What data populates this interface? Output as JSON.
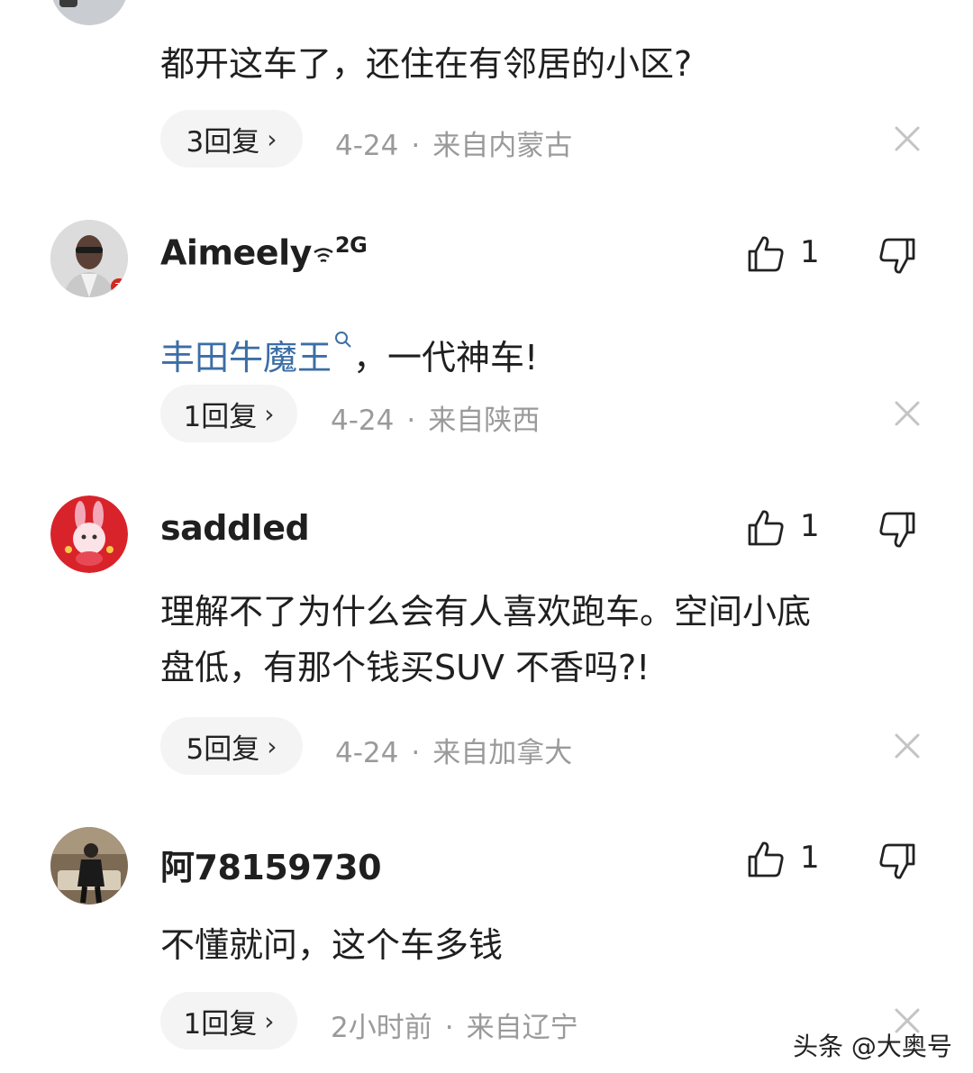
{
  "comments": [
    {
      "username": "",
      "content": "都开这车了，还住在有邻居的小区?",
      "replies": "3回复",
      "date": "4-24",
      "location": "来自内蒙古"
    },
    {
      "username": "Aimeely",
      "badge": "2G",
      "topic": "丰田牛魔王",
      "content": "，一代神车!",
      "likes": "1",
      "replies": "1回复",
      "date": "4-24",
      "location": "来自陕西"
    },
    {
      "username": "saddled",
      "content_line1": "理解不了为什么会有人喜欢跑车。空间小底",
      "content_line2": "盘低，有那个钱买SUV 不香吗?!",
      "likes": "1",
      "replies": "5回复",
      "date": "4-24",
      "location": "来自加拿大"
    },
    {
      "username": "阿78159730",
      "content": "不懂就问，这个车多钱",
      "likes": "1",
      "replies": "1回复",
      "date": "2小时前",
      "location": "来自辽宁"
    }
  ],
  "meta_separator": "·",
  "watermark": "头条 @大奥号",
  "colors": {
    "topic_link": "#3b6ea5",
    "meta_text": "#9a9a9a",
    "pill_bg": "#f4f4f4"
  }
}
